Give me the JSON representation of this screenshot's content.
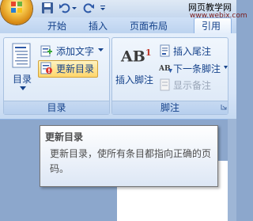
{
  "watermark": {
    "line1": "网页教学网",
    "line2": "www.webjx.com"
  },
  "tabs": [
    "开始",
    "插入",
    "页面布局",
    "引用"
  ],
  "groups": {
    "toc": {
      "label": "目录",
      "toc_button": "目录",
      "add_text": "添加文字",
      "update_toc": "更新目录"
    },
    "footnotes": {
      "label": "脚注",
      "insert_footnote": "插入脚注",
      "insert_endnote": "插入尾注",
      "next_footnote": "下一条脚注",
      "show_notes": "显示备注",
      "ab_glyph": "AB",
      "ab_sup": "1"
    }
  },
  "tooltip": {
    "title": "更新目录",
    "body": "更新目录，使所有条目都指向正确的页码。"
  },
  "colors": {
    "accent": "#15428b",
    "highlight": "#ffd66b"
  }
}
